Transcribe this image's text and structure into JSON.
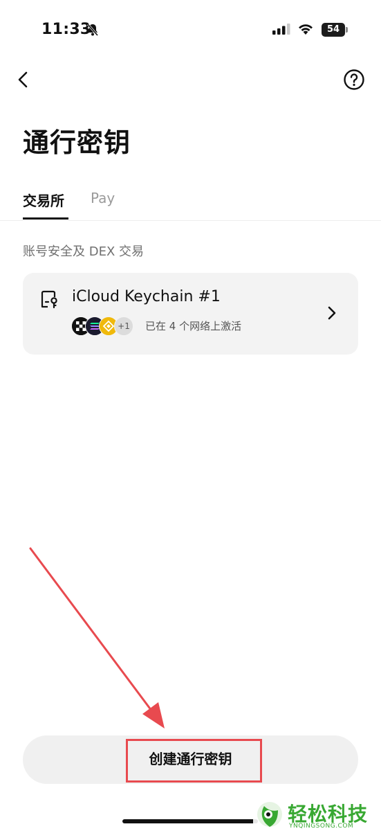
{
  "status_bar": {
    "time": "11:33",
    "battery": "54",
    "icons": [
      "bell-slash-icon",
      "signal-icon",
      "wifi-icon",
      "battery-icon"
    ]
  },
  "nav": {
    "back_icon": "chevron-left-icon",
    "help_icon": "question-circle-icon"
  },
  "page": {
    "title": "通行密钥"
  },
  "tabs": [
    {
      "label": "交易所",
      "active": true
    },
    {
      "label": "Pay",
      "active": false
    }
  ],
  "section": {
    "label": "账号安全及 DEX 交易"
  },
  "passkey_card": {
    "icon": "device-key-icon",
    "title": "iCloud Keychain #1",
    "chains": [
      "okx-icon",
      "solana-icon",
      "bnb-icon"
    ],
    "more_count": "+1",
    "status": "已在 4 个网络上激活",
    "chevron_icon": "chevron-right-icon"
  },
  "bottom": {
    "create_label": "创建通行密钥"
  },
  "annotation": {
    "arrow_color": "#e84a4f",
    "box_color": "#e84a4f"
  },
  "watermark": {
    "title": "轻松科技",
    "subtitle": "YNQINGSONG.COM",
    "color": "#38a832"
  }
}
